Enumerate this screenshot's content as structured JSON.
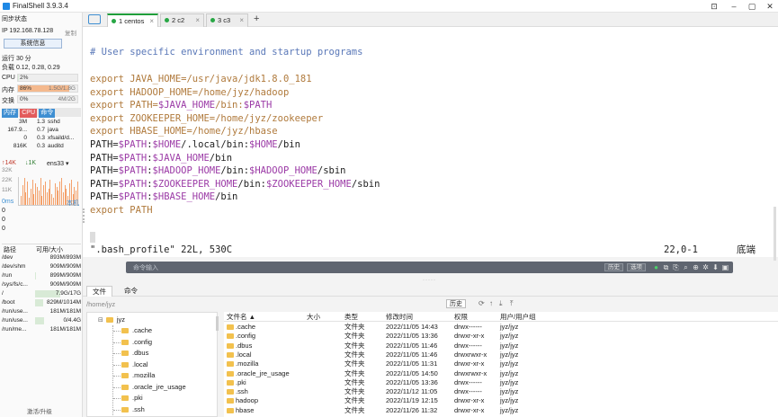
{
  "window": {
    "title": "FinalShell 3.9.3.4"
  },
  "left": {
    "sync_status": "同步状态",
    "ip_label": "IP 192.168.78.128",
    "copy": "复制",
    "sysinfo_btn": "系统信息",
    "uptime": "运行 30 分",
    "load": "负载 0.12, 0.28, 0.29",
    "cpu": {
      "label": "CPU",
      "value": "2%",
      "fraction": 0.02
    },
    "mem": {
      "label": "内存",
      "value": "86%",
      "right": "1.5G/1.8G",
      "fraction": 0.86
    },
    "swap": {
      "label": "交换",
      "value": "0%",
      "right": "4M/2G",
      "fraction": 0.0
    },
    "proc_tabs": [
      "内存",
      "CPU",
      "命令"
    ],
    "processes": [
      {
        "mem": "3M",
        "cpu": "1.3",
        "cmd": "sshd"
      },
      {
        "mem": "167.9...",
        "cpu": "0.7",
        "cmd": "java"
      },
      {
        "mem": "0",
        "cpu": "0.3",
        "cmd": "xfsaild/d..."
      },
      {
        "mem": "816K",
        "cpu": "0.3",
        "cmd": "auditd"
      }
    ],
    "net": {
      "up": "↑14K",
      "down": "↓1K",
      "iface": "ens33",
      "scale": [
        "32K",
        "22K",
        "11K"
      ],
      "bars": [
        10,
        22,
        30,
        14,
        26,
        8,
        18,
        28,
        12,
        24,
        20,
        16,
        30,
        10,
        22,
        26,
        14,
        18,
        28,
        12,
        8,
        24,
        20,
        16,
        26,
        30,
        14,
        22,
        18,
        10,
        24,
        28,
        12,
        20,
        16,
        26
      ]
    },
    "latency": {
      "label": "0ms",
      "host": "本机",
      "values": [
        "0",
        "0",
        "0"
      ]
    },
    "disk_head": {
      "path": "路径",
      "avail": "可用/大小"
    },
    "disks": [
      {
        "path": "/dev",
        "size": "893M/893M",
        "fraction": 0.0
      },
      {
        "path": "/dev/shm",
        "size": "909M/909M",
        "fraction": 0.0
      },
      {
        "path": "/run",
        "size": "899M/909M",
        "fraction": 0.01
      },
      {
        "path": "/sys/fs/c...",
        "size": "909M/909M",
        "fraction": 0.0
      },
      {
        "path": "/",
        "size": "7.9G/17G",
        "fraction": 0.54
      },
      {
        "path": "/boot",
        "size": "829M/1014M",
        "fraction": 0.18
      },
      {
        "path": "/run/use...",
        "size": "181M/181M",
        "fraction": 0.0
      },
      {
        "path": "/run/use...",
        "size": "0/4.4G",
        "fraction": 0.2
      },
      {
        "path": "/run/me...",
        "size": "181M/181M",
        "fraction": 0.0
      }
    ],
    "upgrade": "激活/升级"
  },
  "tabs": [
    {
      "label": "1 centos",
      "active": true
    },
    {
      "label": "2 c2",
      "active": false
    },
    {
      "label": "3 c3",
      "active": false
    }
  ],
  "terminal": {
    "comment": "# User specific environment and startup programs",
    "exports": [
      [
        "export ",
        "JAVA_HOME=/usr/java/jdk1.8.0_181"
      ],
      [
        "export ",
        "HADOOP_HOME=/home/jyz/hadoop"
      ],
      [
        "export ",
        "PATH=$JAVA_HOME/bin:$PATH"
      ],
      [
        "export ",
        "ZOOKEEPER_HOME=/home/jyz/zookeeper"
      ],
      [
        "export ",
        "HBASE_HOME=/home/jyz/hbase"
      ]
    ],
    "paths": [
      "PATH=$PATH:$HOME/.local/bin:$HOME/bin",
      "PATH=$PATH:$JAVA_HOME/bin",
      "PATH=$PATH:$HADOOP_HOME/bin:$HADOOP_HOME/sbin",
      "PATH=$PATH:$ZOOKEEPER_HOME/bin:$ZOOKEEPER_HOME/sbin",
      "PATH=$PATH:$HBASE_HOME/bin"
    ],
    "last": "export PATH",
    "status_file": "\".bash_profile\" 22L, 530C",
    "status_pos": "22,0-1",
    "status_end": "底端"
  },
  "cmdbar": {
    "placeholder": "命令输入",
    "history": "历史",
    "options": "选项"
  },
  "files": {
    "tabs": [
      "文件",
      "命令"
    ],
    "path": "/home/jyz",
    "history_btn": "历史",
    "tree_root": "jyz",
    "tree": [
      ".cache",
      ".config",
      ".dbus",
      ".local",
      ".mozilla",
      ".oracle_jre_usage",
      ".pki",
      ".ssh"
    ],
    "columns": [
      "文件名 ▲",
      "大小",
      "类型",
      "修改时间",
      "权限",
      "用户/用户组"
    ],
    "rows": [
      {
        "name": ".cache",
        "size": "",
        "type": "文件夹",
        "mtime": "2022/11/05 14:43",
        "perm": "drwx------",
        "owner": "jyz/jyz"
      },
      {
        "name": ".config",
        "size": "",
        "type": "文件夹",
        "mtime": "2022/11/05 13:36",
        "perm": "drwxr-xr-x",
        "owner": "jyz/jyz"
      },
      {
        "name": ".dbus",
        "size": "",
        "type": "文件夹",
        "mtime": "2022/11/05 11:46",
        "perm": "drwx------",
        "owner": "jyz/jyz"
      },
      {
        "name": ".local",
        "size": "",
        "type": "文件夹",
        "mtime": "2022/11/05 11:46",
        "perm": "drwxrwxr-x",
        "owner": "jyz/jyz"
      },
      {
        "name": ".mozilla",
        "size": "",
        "type": "文件夹",
        "mtime": "2022/11/05 11:31",
        "perm": "drwxr-xr-x",
        "owner": "jyz/jyz"
      },
      {
        "name": ".oracle_jre_usage",
        "size": "",
        "type": "文件夹",
        "mtime": "2022/11/05 14:50",
        "perm": "drwxrwxr-x",
        "owner": "jyz/jyz"
      },
      {
        "name": ".pki",
        "size": "",
        "type": "文件夹",
        "mtime": "2022/11/05 13:36",
        "perm": "drwx------",
        "owner": "jyz/jyz"
      },
      {
        "name": ".ssh",
        "size": "",
        "type": "文件夹",
        "mtime": "2022/11/12 11:05",
        "perm": "drwx------",
        "owner": "jyz/jyz"
      },
      {
        "name": "hadoop",
        "size": "",
        "type": "文件夹",
        "mtime": "2022/11/19 12:15",
        "perm": "drwxr-xr-x",
        "owner": "jyz/jyz"
      },
      {
        "name": "hbase",
        "size": "",
        "type": "文件夹",
        "mtime": "2022/11/26 11:32",
        "perm": "drwxr-xr-x",
        "owner": "jyz/jyz"
      }
    ]
  },
  "colors": {
    "accent": "#1f9e3a",
    "mem_fill": "#f4a16b",
    "cpu_fill": "#e8f0e8",
    "proc_cpu": "#e35b5b"
  }
}
